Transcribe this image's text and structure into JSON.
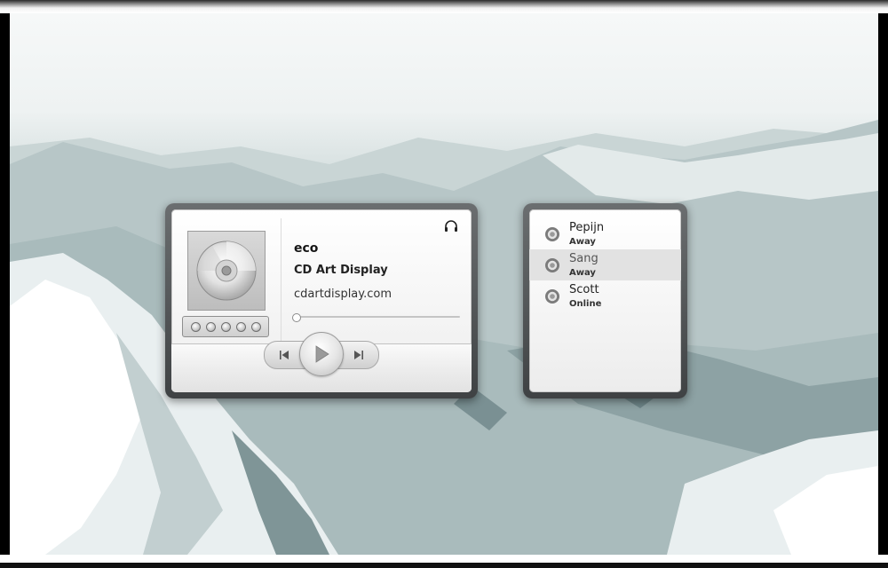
{
  "player": {
    "track_title": "eco",
    "artist": "CD Art Display",
    "website": "cdartdisplay.com",
    "progress": 0.0,
    "rating_max": 5,
    "rating_value": 0,
    "icons": {
      "album_art": "cd-disc-icon",
      "headphones": "headphones-icon",
      "previous": "previous-track-icon",
      "play": "play-icon",
      "next": "next-track-icon"
    }
  },
  "buddies": {
    "items": [
      {
        "name": "Pepijn",
        "status": "Away",
        "selected": false
      },
      {
        "name": "Sang",
        "status": "Away",
        "selected": true
      },
      {
        "name": "Scott",
        "status": "Online",
        "selected": false
      }
    ],
    "icon": "buddy-status-icon"
  },
  "colors": {
    "frame": "#4a4d4f",
    "panel": "#f4f4f4",
    "selected_row": "#e2e2e2"
  }
}
